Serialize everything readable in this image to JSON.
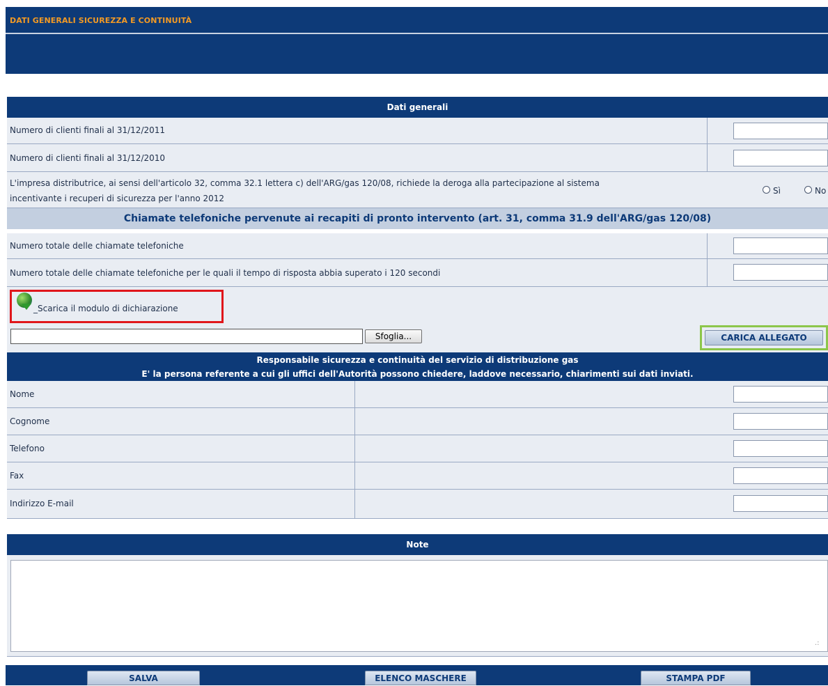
{
  "banner": {
    "title": "DATI GENERALI SICUREZZA E CONTINUITÀ"
  },
  "dati_generali": {
    "header": "Dati generali",
    "rows": [
      {
        "label": "Numero di clienti finali al 31/12/2011",
        "value": ""
      },
      {
        "label": "Numero di clienti finali al 31/12/2010",
        "value": ""
      }
    ],
    "deroga": {
      "label_line1": "L'impresa distributrice, ai sensi dell'articolo 32, comma 32.1 lettera c) dell'ARG/gas 120/08, richiede la deroga alla partecipazione al sistema",
      "label_line2": "incentivante i recuperi di sicurezza per l'anno 2012",
      "option_yes": "Sì",
      "option_no": "No"
    }
  },
  "chiamate": {
    "header": "Chiamate telefoniche pervenute ai recapiti di pronto intervento (art. 31, comma 31.9 dell'ARG/gas 120/08)",
    "rows": [
      {
        "label": "Numero totale delle chiamate telefoniche",
        "value": ""
      },
      {
        "label": "Numero totale delle chiamate telefoniche per le quali il tempo di risposta abbia superato i 120 secondi",
        "value": ""
      }
    ]
  },
  "allegato": {
    "download_link": "_Scarica il modulo di dichiarazione",
    "file_value": "",
    "browse_label": "Sfoglia...",
    "upload_label": "CARICA ALLEGATO"
  },
  "responsabile": {
    "header_line1": "Responsabile sicurezza e continuità del servizio di distribuzione gas",
    "header_line2": "E' la persona referente a cui gli uffici dell'Autorità possono chiedere, laddove necessario, chiarimenti sui dati inviati.",
    "fields": [
      {
        "label": "Nome",
        "value": ""
      },
      {
        "label": "Cognome",
        "value": ""
      },
      {
        "label": "Telefono",
        "value": ""
      },
      {
        "label": "Fax",
        "value": ""
      },
      {
        "label": "Indirizzo E-mail",
        "value": ""
      }
    ]
  },
  "note": {
    "header": "Note",
    "value": ""
  },
  "footer": {
    "save_label": "SALVA",
    "list_label": "ELENCO MASCHERE",
    "pdf_label": "STAMPA PDF"
  }
}
